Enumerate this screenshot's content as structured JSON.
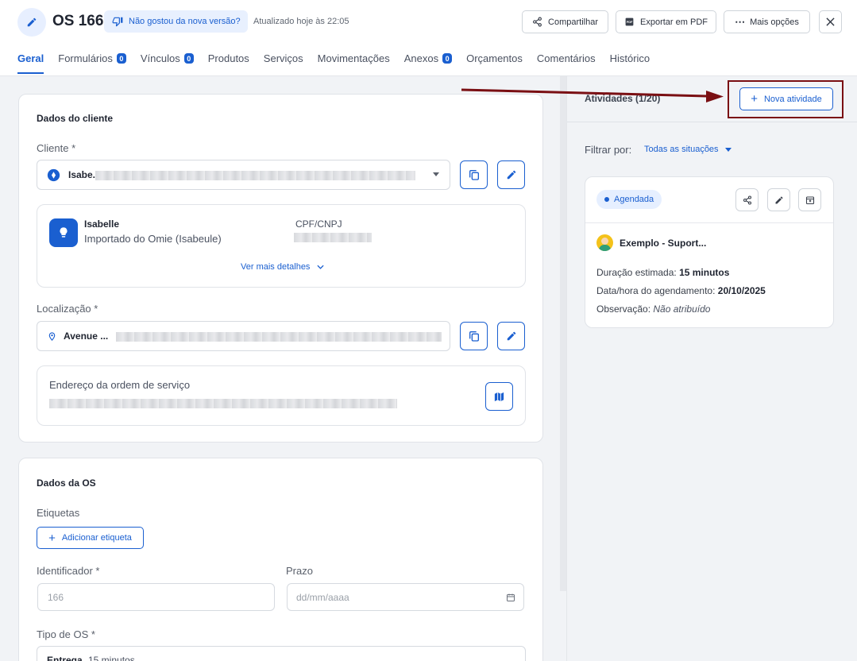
{
  "header": {
    "title": "OS 166",
    "feedback_label": "Não gostou da nova versão?",
    "updated_text": "Atualizado hoje às 22:05",
    "share_label": "Compartilhar",
    "pdf_label": "Exportar em PDF",
    "more_label": "Mais opções"
  },
  "tabs": [
    {
      "label": "Geral",
      "active": true
    },
    {
      "label": "Formulários",
      "badge": "0"
    },
    {
      "label": "Vínculos",
      "badge": "0"
    },
    {
      "label": "Produtos"
    },
    {
      "label": "Serviços"
    },
    {
      "label": "Movimentações"
    },
    {
      "label": "Anexos",
      "badge": "0"
    },
    {
      "label": "Orçamentos"
    },
    {
      "label": "Comentários"
    },
    {
      "label": "Histórico"
    }
  ],
  "client_section": {
    "title": "Dados do cliente",
    "client_label": "Cliente *",
    "client_value": "Isabe.",
    "client_name": "Isabelle",
    "client_origin": "Importado do Omie (Isabeule)",
    "doc_label": "CPF/CNPJ",
    "details_link": "Ver mais detalhes",
    "location_label": "Localização *",
    "location_value": "Avenue ...",
    "address_label": "Endereço da ordem de serviço"
  },
  "os_section": {
    "title": "Dados da OS",
    "tags_label": "Etiquetas",
    "add_tag_label": "Adicionar etiqueta",
    "identifier_label": "Identificador *",
    "identifier_value": "166",
    "deadline_label": "Prazo",
    "deadline_placeholder": "dd/mm/aaaa",
    "type_label": "Tipo de OS *",
    "type_value": "Entrega",
    "type_detail": "15 minutos"
  },
  "activities": {
    "title": "Atividades (1/20)",
    "new_label": "Nova atividade",
    "filter_label": "Filtrar por:",
    "filter_value": "Todas as situações",
    "card": {
      "status": "Agendada",
      "name": "Exemplo - Suport...",
      "duration_label": "Duração estimada:",
      "duration_value": "15 minutos",
      "schedule_label": "Data/hora do agendamento:",
      "schedule_value": "20/10/2025",
      "note_label": "Observação:",
      "note_value": "Não atribuído"
    }
  },
  "colors": {
    "accent": "#1a5fd0",
    "highlight": "#7a0f13"
  }
}
